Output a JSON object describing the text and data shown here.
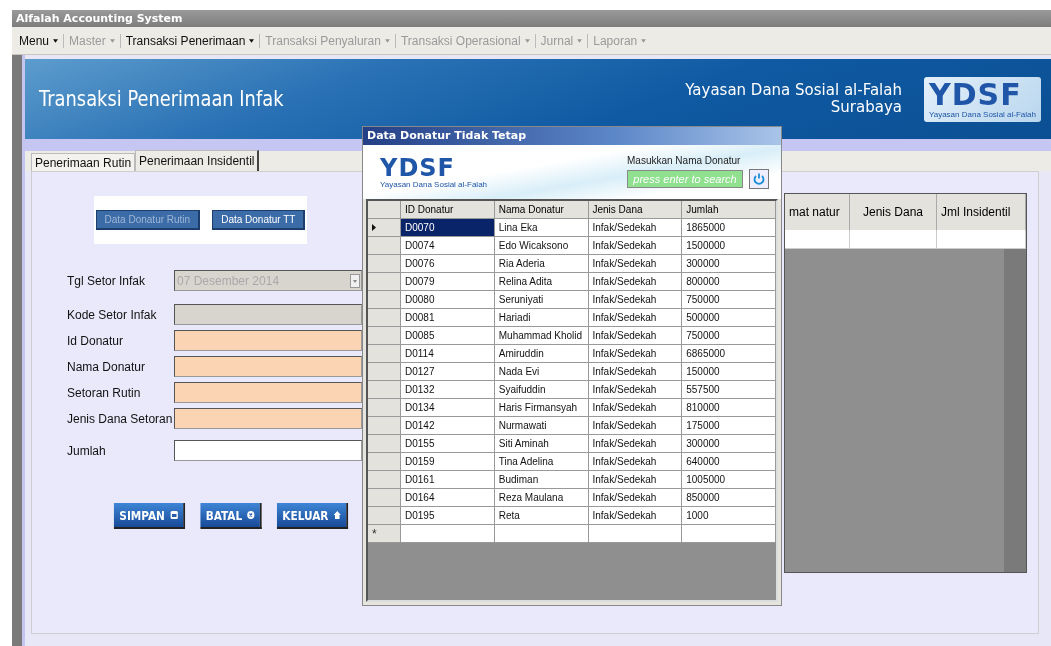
{
  "window": {
    "title": "Alfalah Accounting System"
  },
  "menu": [
    {
      "label": "Menu",
      "disabled": false
    },
    {
      "label": "Master",
      "disabled": true
    },
    {
      "label": "Transaksi Penerimaan",
      "disabled": false
    },
    {
      "label": "Transaksi Penyaluran",
      "disabled": true
    },
    {
      "label": "Transaksi Operasional",
      "disabled": true
    },
    {
      "label": "Jurnal",
      "disabled": true
    },
    {
      "label": "Laporan",
      "disabled": true
    }
  ],
  "banner": {
    "title": "Transaksi Penerimaan Infak",
    "org_name": "Yayasan Dana Sosial al-Falah",
    "org_city": "Surabaya",
    "logo": "YDSF",
    "logo_caption": "Yayasan Dana Sosial al-Falah"
  },
  "tabs": [
    {
      "label": "Penerimaan Rutin",
      "selected": false
    },
    {
      "label": "Penerimaan Insidentil",
      "selected": true
    }
  ],
  "data_buttons": [
    {
      "label": "Data Donatur Rutin",
      "disabled": true
    },
    {
      "label": "Data Donatur TT",
      "disabled": false
    }
  ],
  "form": [
    {
      "label": "Tgl Setor Infak",
      "kind": "date",
      "value": "07 Desember 2014",
      "disabled": true
    },
    {
      "label": "Kode Setor Infak",
      "kind": "text",
      "disabled": true
    },
    {
      "label": "Id Donatur",
      "kind": "text",
      "disabled": false,
      "readonly": true
    },
    {
      "label": "Nama Donatur",
      "kind": "text",
      "disabled": false,
      "readonly": true
    },
    {
      "label": "Setoran Rutin",
      "kind": "text",
      "disabled": false,
      "readonly": true
    },
    {
      "label": "Jenis Dana Setoran",
      "kind": "text",
      "disabled": false,
      "readonly": true
    },
    {
      "label": "Jumlah",
      "kind": "text",
      "disabled": false,
      "readonly": false
    }
  ],
  "actions": [
    {
      "label": "SIMPAN",
      "kind": "save"
    },
    {
      "label": "BATAL",
      "kind": "cancel"
    },
    {
      "label": "KELUAR",
      "kind": "home"
    }
  ],
  "detail_table": {
    "columns": [
      "mat natur",
      "Jenis Dana",
      "Jml Insidentil"
    ]
  },
  "dialog": {
    "title": "Data Donatur Tidak Tetap",
    "logo": "YDSF",
    "logo_caption": "Yayasan Dana Sosial al-Falah",
    "search_label": "Masukkan Nama Donatur",
    "search_placeholder": "press enter to search",
    "columns": [
      "ID Donatur",
      "Nama Donatur",
      "Jenis Dana",
      "Jumlah"
    ],
    "rows": [
      {
        "cells": [
          "D0070",
          "Lina Eka",
          "Infak/Sedekah",
          "1865000"
        ],
        "selected": true
      },
      {
        "cells": [
          "D0074",
          "Edo Wicaksono",
          "Infak/Sedekah",
          "1500000"
        ],
        "selected": false
      },
      {
        "cells": [
          "D0076",
          "Ria Aderia",
          "Infak/Sedekah",
          "300000"
        ],
        "selected": false
      },
      {
        "cells": [
          "D0079",
          "Relina Adita",
          "Infak/Sedekah",
          "800000"
        ],
        "selected": false
      },
      {
        "cells": [
          "D0080",
          "Seruniyati",
          "Infak/Sedekah",
          "750000"
        ],
        "selected": false
      },
      {
        "cells": [
          "D0081",
          "Hariadi",
          "Infak/Sedekah",
          "500000"
        ],
        "selected": false
      },
      {
        "cells": [
          "D0085",
          "Muhammad Kholid",
          "Infak/Sedekah",
          "750000"
        ],
        "selected": false
      },
      {
        "cells": [
          "D0114",
          "Amiruddin",
          "Infak/Sedekah",
          "6865000"
        ],
        "selected": false
      },
      {
        "cells": [
          "D0127",
          "Nada Evi",
          "Infak/Sedekah",
          "150000"
        ],
        "selected": false
      },
      {
        "cells": [
          "D0132",
          "Syaifuddin",
          "Infak/Sedekah",
          "557500"
        ],
        "selected": false
      },
      {
        "cells": [
          "D0134",
          "Haris Firmansyah",
          "Infak/Sedekah",
          "810000"
        ],
        "selected": false
      },
      {
        "cells": [
          "D0142",
          "Nurmawati",
          "Infak/Sedekah",
          "175000"
        ],
        "selected": false
      },
      {
        "cells": [
          "D0155",
          "Siti Aminah",
          "Infak/Sedekah",
          "300000"
        ],
        "selected": false
      },
      {
        "cells": [
          "D0159",
          "Tina Adelina",
          "Infak/Sedekah",
          "640000"
        ],
        "selected": false
      },
      {
        "cells": [
          "D0161",
          "Budiman",
          "Infak/Sedekah",
          "1005000"
        ],
        "selected": false
      },
      {
        "cells": [
          "D0164",
          "Reza Maulana",
          "Infak/Sedekah",
          "850000"
        ],
        "selected": false
      },
      {
        "cells": [
          "D0195",
          "Reta",
          "Infak/Sedekah",
          "1000"
        ],
        "selected": false
      }
    ],
    "new_row_marker": "*"
  }
}
